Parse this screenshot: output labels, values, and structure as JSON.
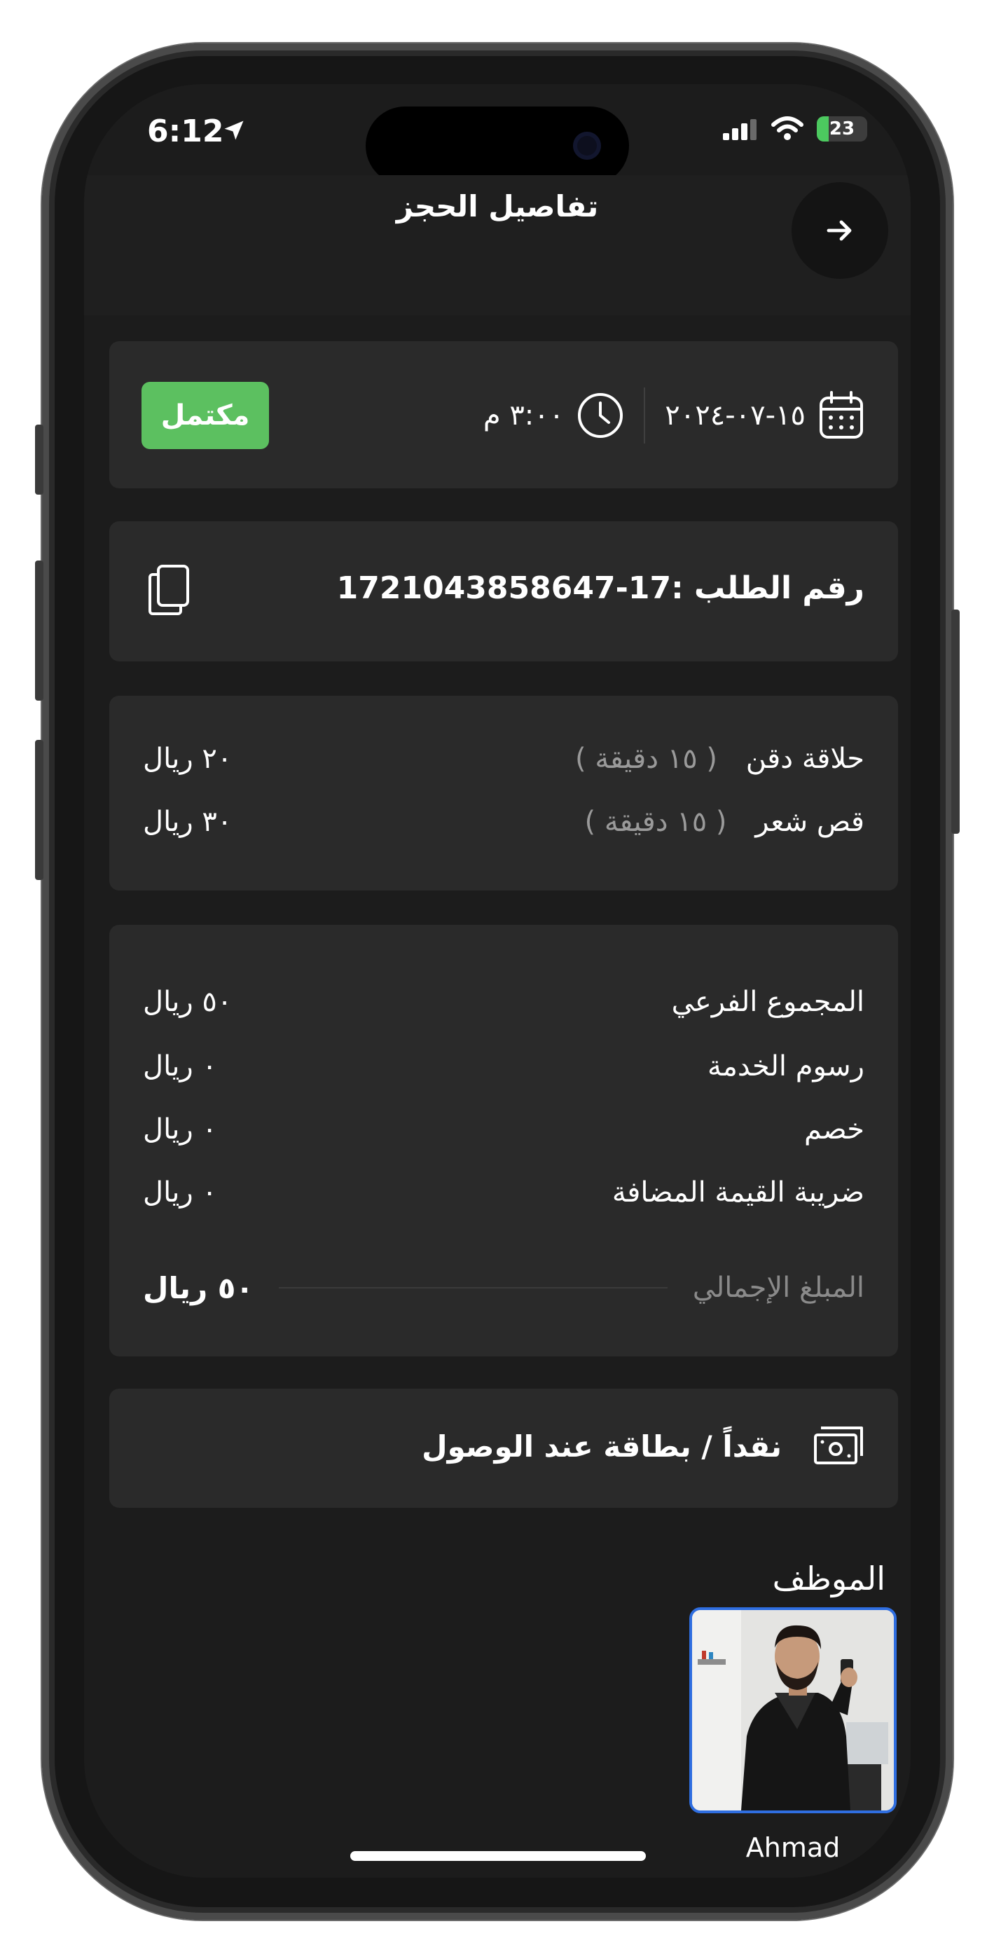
{
  "status_bar": {
    "time": "6:12",
    "battery": "23",
    "battery_level": 0.23
  },
  "header": {
    "title": "تفاصيل الحجز"
  },
  "booking": {
    "date": "١٥-٠٧-٢٠٢٤",
    "time": "٣:٠٠ م",
    "status": "مكتمل",
    "status_color": "#5cc060"
  },
  "order": {
    "number_text": "رقم الطلب :17-1721043858647"
  },
  "services": [
    {
      "name": "حلاقة دقن",
      "duration": "( ١٥ دقيقة )",
      "price": "٢٠ ريال"
    },
    {
      "name": "قص شعر",
      "duration": "( ١٥ دقيقة )",
      "price": "٣٠ ريال"
    }
  ],
  "summary": {
    "rows": [
      {
        "label": "المجموع الفرعي",
        "value": "٥٠ ريال"
      },
      {
        "label": "رسوم الخدمة",
        "value": "٠ ريال"
      },
      {
        "label": "خصم",
        "value": "٠ ريال"
      },
      {
        "label": "ضريبة القيمة المضافة",
        "value": "٠ ريال"
      }
    ],
    "total_label": "المبلغ الإجمالي",
    "total_value": "٥٠ ريال"
  },
  "payment": {
    "method": "نقداً / بطاقة عند الوصول"
  },
  "employee": {
    "section_title": "الموظف",
    "name": "Ahmad",
    "highlight_color": "#2f6ee0"
  },
  "icons": {
    "back": "arrow-right-icon",
    "calendar": "calendar-icon",
    "clock": "clock-icon",
    "copy": "copy-icon",
    "cash": "cash-icon",
    "location": "location-arrow-icon",
    "signal": "signal-icon",
    "wifi": "wifi-icon",
    "battery": "battery-icon"
  }
}
